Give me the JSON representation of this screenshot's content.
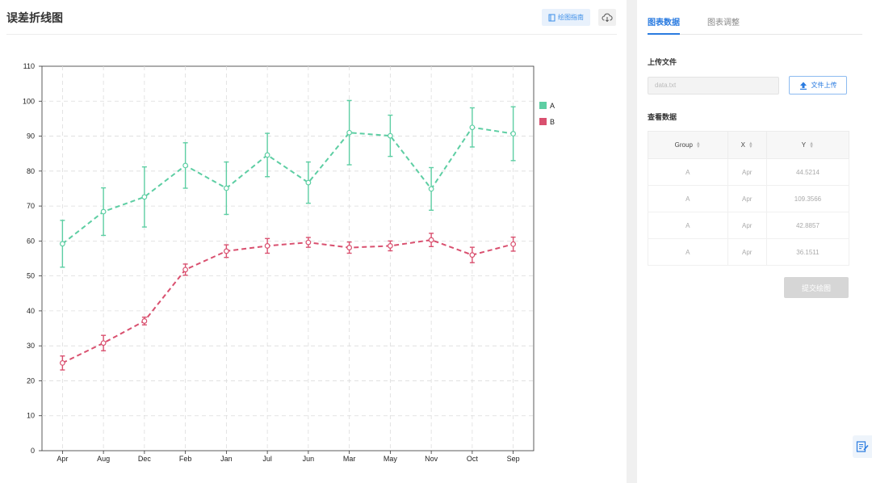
{
  "page": {
    "title": "误差折线图"
  },
  "toolbar": {
    "guide_label": "绘图指南",
    "guide_icon": "book-icon",
    "download_icon": "cloud-download-icon"
  },
  "tabs": [
    {
      "label": "图表数据",
      "active": true
    },
    {
      "label": "图表调整",
      "active": false
    }
  ],
  "upload": {
    "section_title": "上传文件",
    "file_placeholder": "data.txt",
    "button_label": "文件上传"
  },
  "view": {
    "section_title": "查看数据",
    "columns": [
      "Group",
      "X",
      "Y"
    ],
    "rows": [
      [
        "A",
        "Apr",
        "44.5214"
      ],
      [
        "A",
        "Apr",
        "109.3566"
      ],
      [
        "A",
        "Apr",
        "42.8857"
      ],
      [
        "A",
        "Apr",
        "36.1511"
      ]
    ]
  },
  "submit_label": "提交绘图",
  "colors": {
    "A": "#5dcea3",
    "B": "#d9506f",
    "accent": "#2a7be0"
  },
  "chart_data": {
    "type": "line",
    "categories": [
      "Apr",
      "Aug",
      "Dec",
      "Feb",
      "Jan",
      "Jul",
      "Jun",
      "Mar",
      "May",
      "Nov",
      "Oct",
      "Sep"
    ],
    "ylim": [
      0,
      110
    ],
    "yticks": [
      0,
      10,
      20,
      30,
      40,
      50,
      60,
      70,
      80,
      90,
      100,
      110
    ],
    "grid": true,
    "legend": "top-right",
    "series": [
      {
        "name": "A",
        "values": [
          59.2,
          68.4,
          72.6,
          81.6,
          75.1,
          84.6,
          76.7,
          91.0,
          90.1,
          74.9,
          92.5,
          90.7
        ],
        "err_low": [
          52.5,
          61.6,
          64.0,
          75.1,
          67.6,
          78.4,
          70.8,
          81.8,
          84.2,
          68.8,
          86.9,
          83.0
        ],
        "err_high": [
          65.9,
          75.2,
          81.2,
          88.1,
          82.6,
          90.8,
          82.6,
          100.2,
          96.0,
          81.0,
          98.1,
          98.4
        ]
      },
      {
        "name": "B",
        "values": [
          25.1,
          30.8,
          37.1,
          51.8,
          57.1,
          58.6,
          59.6,
          58.1,
          58.6,
          60.3,
          56.0,
          59.1
        ],
        "err_low": [
          23.1,
          28.6,
          36.0,
          50.2,
          55.3,
          56.5,
          58.2,
          56.5,
          57.2,
          58.4,
          53.8,
          57.1
        ],
        "err_high": [
          27.1,
          33.0,
          38.2,
          53.4,
          58.9,
          60.7,
          61.0,
          59.7,
          60.0,
          62.2,
          58.2,
          61.1
        ]
      }
    ]
  }
}
